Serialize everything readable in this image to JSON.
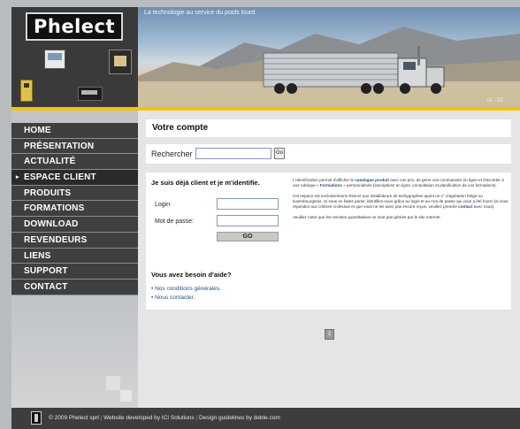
{
  "header": {
    "logo_text": "Phelect",
    "tagline": "La technologie au service du poids lourd.",
    "pager": "01 - 02"
  },
  "nav": {
    "items": [
      {
        "label": "HOME",
        "active": false
      },
      {
        "label": "PRÉSENTATION",
        "active": false
      },
      {
        "label": "ACTUALITÉ",
        "active": false
      },
      {
        "label": "ESPACE CLIENT",
        "active": true
      },
      {
        "label": "PRODUITS",
        "active": false
      },
      {
        "label": "FORMATIONS",
        "active": false
      },
      {
        "label": "DOWNLOAD",
        "active": false
      },
      {
        "label": "REVENDEURS",
        "active": false
      },
      {
        "label": "LIENS",
        "active": false
      },
      {
        "label": "SUPPORT",
        "active": false
      },
      {
        "label": "CONTACT",
        "active": false
      }
    ],
    "active_marker": "▸"
  },
  "main": {
    "title": "Votre compte",
    "search": {
      "label": "Rechercher",
      "value": "",
      "button": "Go"
    },
    "login": {
      "heading": "Je suis déjà client et je m'identifie.",
      "login_label": "Login",
      "password_label": "Mot de passe:",
      "go_button": "GO"
    },
    "info": {
      "p1_a": "L'identification permet d'afficher le ",
      "p1_link": "catalogue produit",
      "p1_b": " avec vos prix, de gérer vos commandes en ligne et d'accéder à une rubrique « ",
      "p1_link2": "Formations",
      "p1_c": " » personnalisée (inscriptions en ligne, consultation et planification de vos formations).",
      "p2_a": "Cet espace est exclusivement réservé aux installateurs de tachygraphes ayant un n° d'agréation belge ou luxembourgeois. Si vous en faites partie, identifiez-vous grâce au login et au mot de passe qui vous a été fourni (si vous répondez aux critères ci-dessus et que vous ne les avez pas encore reçus, veuillez prendre ",
      "p2_link": "contact",
      "p2_b": " avec nous).",
      "p3": "Veuillez noter que les remises quantitatives ne sont pas gérées par le site Internet."
    },
    "help": {
      "heading": "Vous avez besoin d'aide?",
      "links": [
        "• Nos conditions générales.",
        "• Nous contacter."
      ]
    },
    "page_icon": "1"
  },
  "footer": {
    "copyright": "© 2009 Phelect sprl",
    "developer": "Website developed by ICI Solutions",
    "design": "Design guidelines by debie.com",
    "separator": "|"
  }
}
